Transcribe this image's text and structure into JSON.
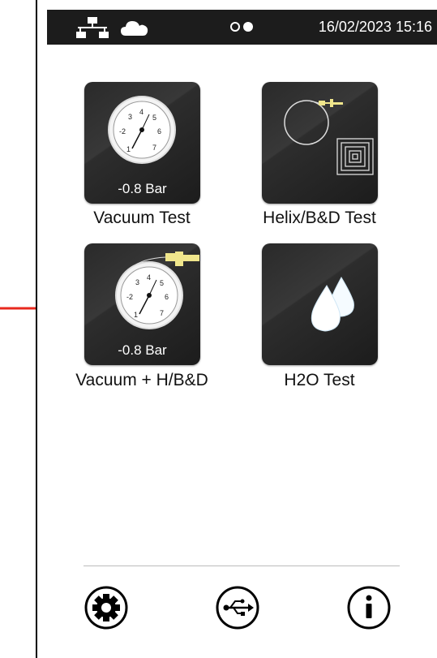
{
  "status_bar": {
    "datetime": "16/02/2023 15:16",
    "icons": [
      "network-icon",
      "cloud-icon",
      "indicator-dot-empty",
      "indicator-dot-filled"
    ]
  },
  "tiles": [
    {
      "label": "Vacuum Test",
      "pressure": "-0.8 Bar",
      "icon": "gauge-icon"
    },
    {
      "label": "Helix/B&D Test",
      "icon": "helix-coil-icon"
    },
    {
      "label": "Vacuum + H/B&D",
      "pressure": "-0.8 Bar",
      "icon": "gauge-with-helix-icon"
    },
    {
      "label": "H2O Test",
      "icon": "water-drops-icon"
    }
  ],
  "gauge_scale": [
    "-2",
    "1",
    "3",
    "4",
    "5",
    "6",
    "7"
  ],
  "footer": {
    "icons": [
      "settings-gear-icon",
      "usb-icon",
      "info-icon"
    ]
  },
  "colors": {
    "tile": "#2a2a2a",
    "status_bar": "#1c1c1c",
    "arrow": "#e8281e",
    "helix_connector": "#f0e68c",
    "drop": "#f5fbff"
  }
}
